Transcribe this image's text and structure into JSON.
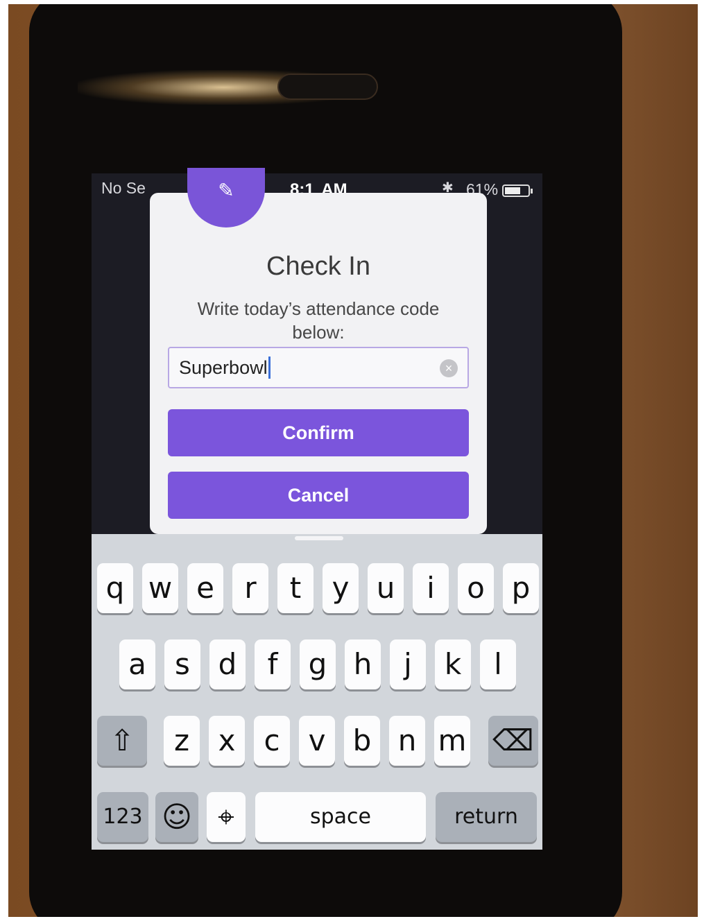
{
  "status_bar": {
    "carrier": "No Se",
    "wifi_icon": "wifi-icon",
    "time": "8:1  AM",
    "bluetooth_icon": "bluetooth-icon",
    "battery_percent": "61%",
    "battery_icon": "battery-icon"
  },
  "dialog": {
    "badge_icon": "pencil-icon",
    "title": "Check In",
    "message": "Write today’s attendance code below:",
    "input_value": "Superbowl",
    "clear_icon": "clear-x-icon",
    "confirm_label": "Confirm",
    "cancel_label": "Cancel",
    "accent_color": "#7b55dc"
  },
  "keyboard": {
    "row1": [
      "q",
      "w",
      "e",
      "r",
      "t",
      "y",
      "u",
      "i",
      "o",
      "p"
    ],
    "row2": [
      "a",
      "s",
      "d",
      "f",
      "g",
      "h",
      "j",
      "k",
      "l"
    ],
    "row3": [
      "z",
      "x",
      "c",
      "v",
      "b",
      "n",
      "m"
    ],
    "shift_icon": "shift-icon",
    "delete_icon": "delete-icon",
    "numbers_label": "123",
    "emoji_icon": "emoji-icon",
    "mic_icon": "microphone-icon",
    "space_label": "space",
    "return_label": "return"
  }
}
